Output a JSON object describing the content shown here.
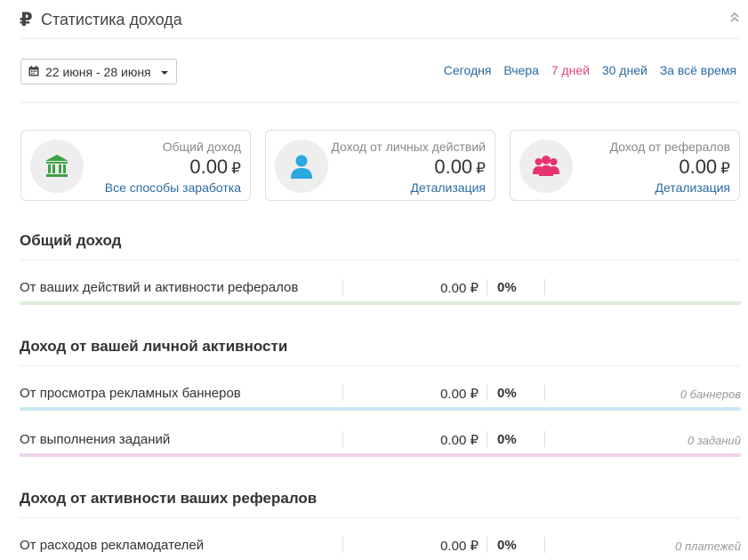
{
  "header": {
    "title": "Статистика дохода"
  },
  "date_filter": {
    "range": "22 июня - 28 июня"
  },
  "periods": [
    {
      "label": "Сегодня",
      "active": false
    },
    {
      "label": "Вчера",
      "active": false
    },
    {
      "label": "7 дней",
      "active": true
    },
    {
      "label": "30 дней",
      "active": false
    },
    {
      "label": "За всё время",
      "active": false
    }
  ],
  "cards": [
    {
      "title": "Общий доход",
      "value": "0.00",
      "currency": "₽",
      "link": "Все способы заработка",
      "icon": "bank-icon",
      "icon_color": "#3ea145"
    },
    {
      "title": "Доход от личных действий",
      "value": "0.00",
      "currency": "₽",
      "link": "Детализация",
      "icon": "user-icon",
      "icon_color": "#2aa8e0"
    },
    {
      "title": "Доход от рефералов",
      "value": "0.00",
      "currency": "₽",
      "link": "Детализация",
      "icon": "users-icon",
      "icon_color": "#e8336f"
    }
  ],
  "sections": [
    {
      "title": "Общий доход",
      "rows": [
        {
          "label": "От ваших действий и активности рефералов",
          "amount": "0.00 ₽",
          "percent": "0%",
          "count": "",
          "bar_color": "#dcefd6"
        }
      ]
    },
    {
      "title": "Доход от вашей личной активности",
      "rows": [
        {
          "label": "От просмотра рекламных баннеров",
          "amount": "0.00 ₽",
          "percent": "0%",
          "count": "0 баннеров",
          "bar_color": "#cdeaf5"
        },
        {
          "label": "От выполнения заданий",
          "amount": "0.00 ₽",
          "percent": "0%",
          "count": "0 заданий",
          "bar_color": "#ecd2ec"
        }
      ]
    },
    {
      "title": "Доход от активности ваших рефералов",
      "rows": [
        {
          "label": "От расходов рекламодателей",
          "amount": "0.00 ₽",
          "percent": "0%",
          "count": "0 платежей",
          "bar_color": "#f5dcc8"
        }
      ]
    }
  ]
}
